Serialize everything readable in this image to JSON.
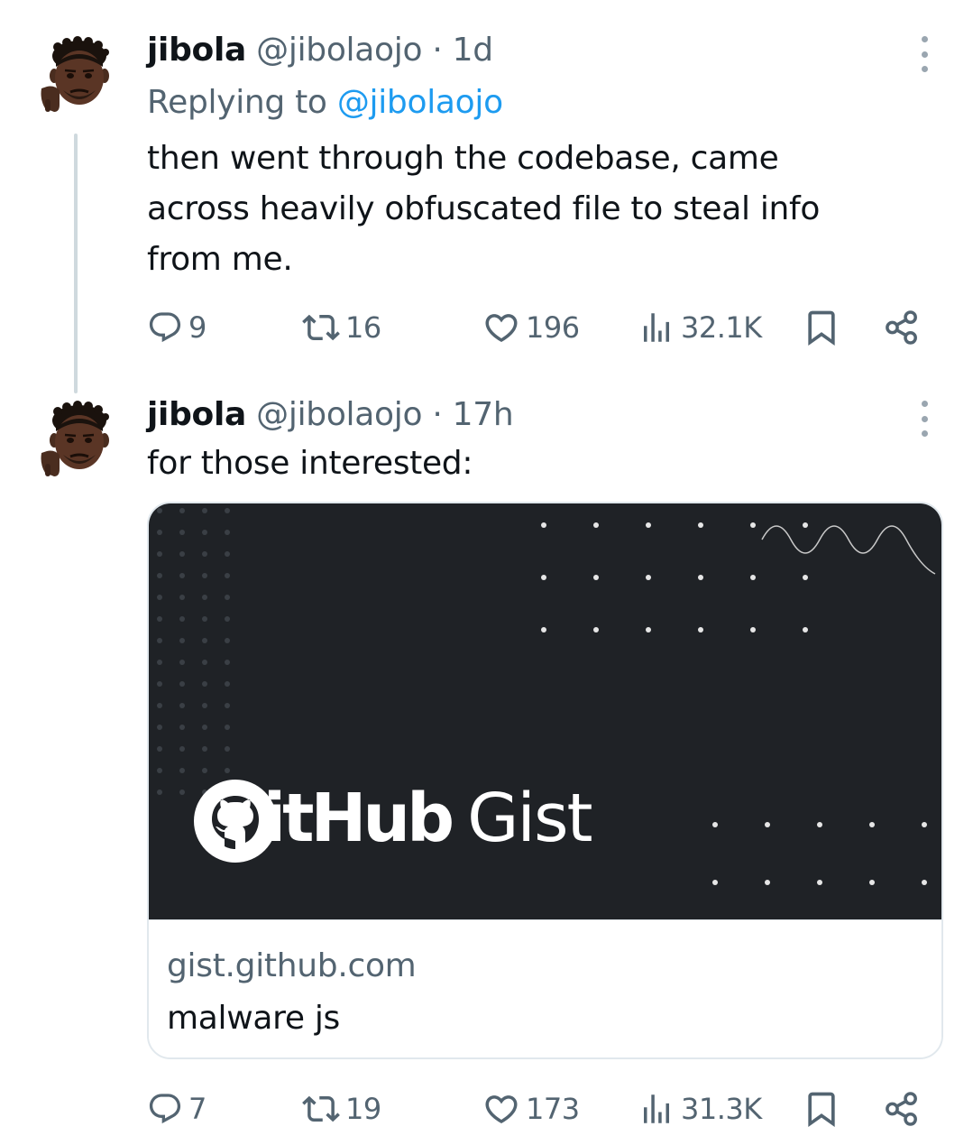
{
  "tweets": [
    {
      "display_name": "jibola",
      "handle": "@jibolaojo",
      "separator": "·",
      "time": "1d",
      "replying_label": "Replying to",
      "replying_to": "@jibolaojo",
      "text_lines": [
        "then went through the codebase, came",
        "across heavily obfuscated file to steal info",
        "from me."
      ],
      "replies": "9",
      "reposts": "16",
      "likes": "196",
      "views": "32.1K"
    },
    {
      "display_name": "jibola",
      "handle": "@jibolaojo",
      "separator": "·",
      "time": "17h",
      "text": "for those interested:",
      "card": {
        "image_brand_bold": "GitHub",
        "image_brand_light": "Gist",
        "domain": "gist.github.com",
        "title": "malware js"
      },
      "replies": "7",
      "reposts": "19",
      "likes": "173",
      "views": "31.3K"
    }
  ],
  "icons": {
    "reply": "reply-icon",
    "repost": "repost-icon",
    "like": "heart-icon",
    "views": "views-icon",
    "bookmark": "bookmark-icon",
    "share": "share-icon",
    "more": "more-vertical-icon",
    "github": "github-logo-icon"
  },
  "colors": {
    "text": "#0f1419",
    "secondary": "#536471",
    "accent": "#1d9bf0",
    "card_bg": "#1f2226",
    "thread_line": "#cfd9de"
  }
}
